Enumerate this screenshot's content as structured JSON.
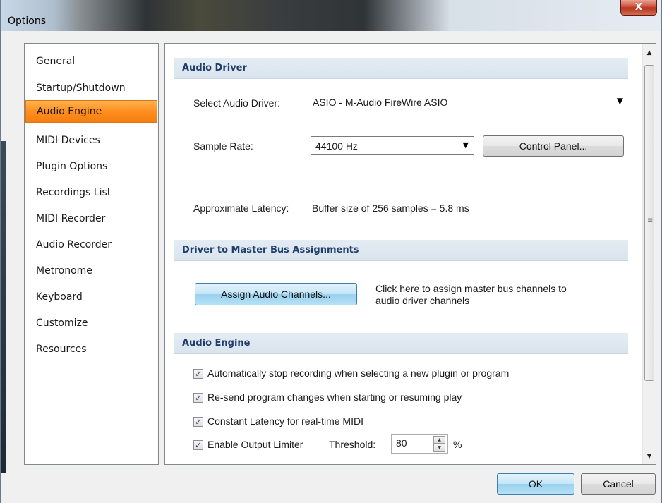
{
  "window": {
    "title": "Options",
    "close_label": "X"
  },
  "nav": {
    "items": [
      {
        "label": "General"
      },
      {
        "label": "Startup/Shutdown"
      },
      {
        "label": "Audio Engine",
        "selected": true
      },
      {
        "label": "MIDI Devices"
      },
      {
        "label": "Plugin Options"
      },
      {
        "label": "Recordings List"
      },
      {
        "label": "MIDI Recorder"
      },
      {
        "label": "Audio Recorder"
      },
      {
        "label": "Metronome"
      },
      {
        "label": "Keyboard"
      },
      {
        "label": "Customize"
      },
      {
        "label": "Resources"
      }
    ]
  },
  "audio_driver": {
    "header": "Audio Driver",
    "select_label": "Select Audio Driver:",
    "driver_value": "ASIO - M-Audio FireWire ASIO",
    "sample_rate_label": "Sample Rate:",
    "sample_rate_value": "44100 Hz",
    "control_panel_label": "Control Panel...",
    "latency_label": "Approximate Latency:",
    "latency_value": "Buffer size of 256 samples = 5.8 ms"
  },
  "master_bus": {
    "header": "Driver to Master Bus Assignments",
    "assign_button": "Assign Audio Channels...",
    "hint_line1": "Click here to assign master bus channels to",
    "hint_line2": "audio driver channels"
  },
  "audio_engine": {
    "header": "Audio Engine",
    "options": [
      {
        "label": "Automatically stop recording when selecting a new plugin or program",
        "checked": true
      },
      {
        "label": "Re-send program changes when starting or resuming play",
        "checked": true
      },
      {
        "label": "Constant Latency for real-time MIDI",
        "checked": true
      },
      {
        "label": "Enable Output Limiter",
        "checked": true
      }
    ],
    "threshold_label": "Threshold:",
    "threshold_value": "80",
    "threshold_unit": "%"
  },
  "footer": {
    "ok_label": "OK",
    "cancel_label": "Cancel"
  },
  "colors": {
    "selected_nav": "#ff8c1c",
    "section_header_text": "#1f3e6a",
    "section_header_bg": "#dfe8f0",
    "ok_button": "#98d1ef"
  }
}
